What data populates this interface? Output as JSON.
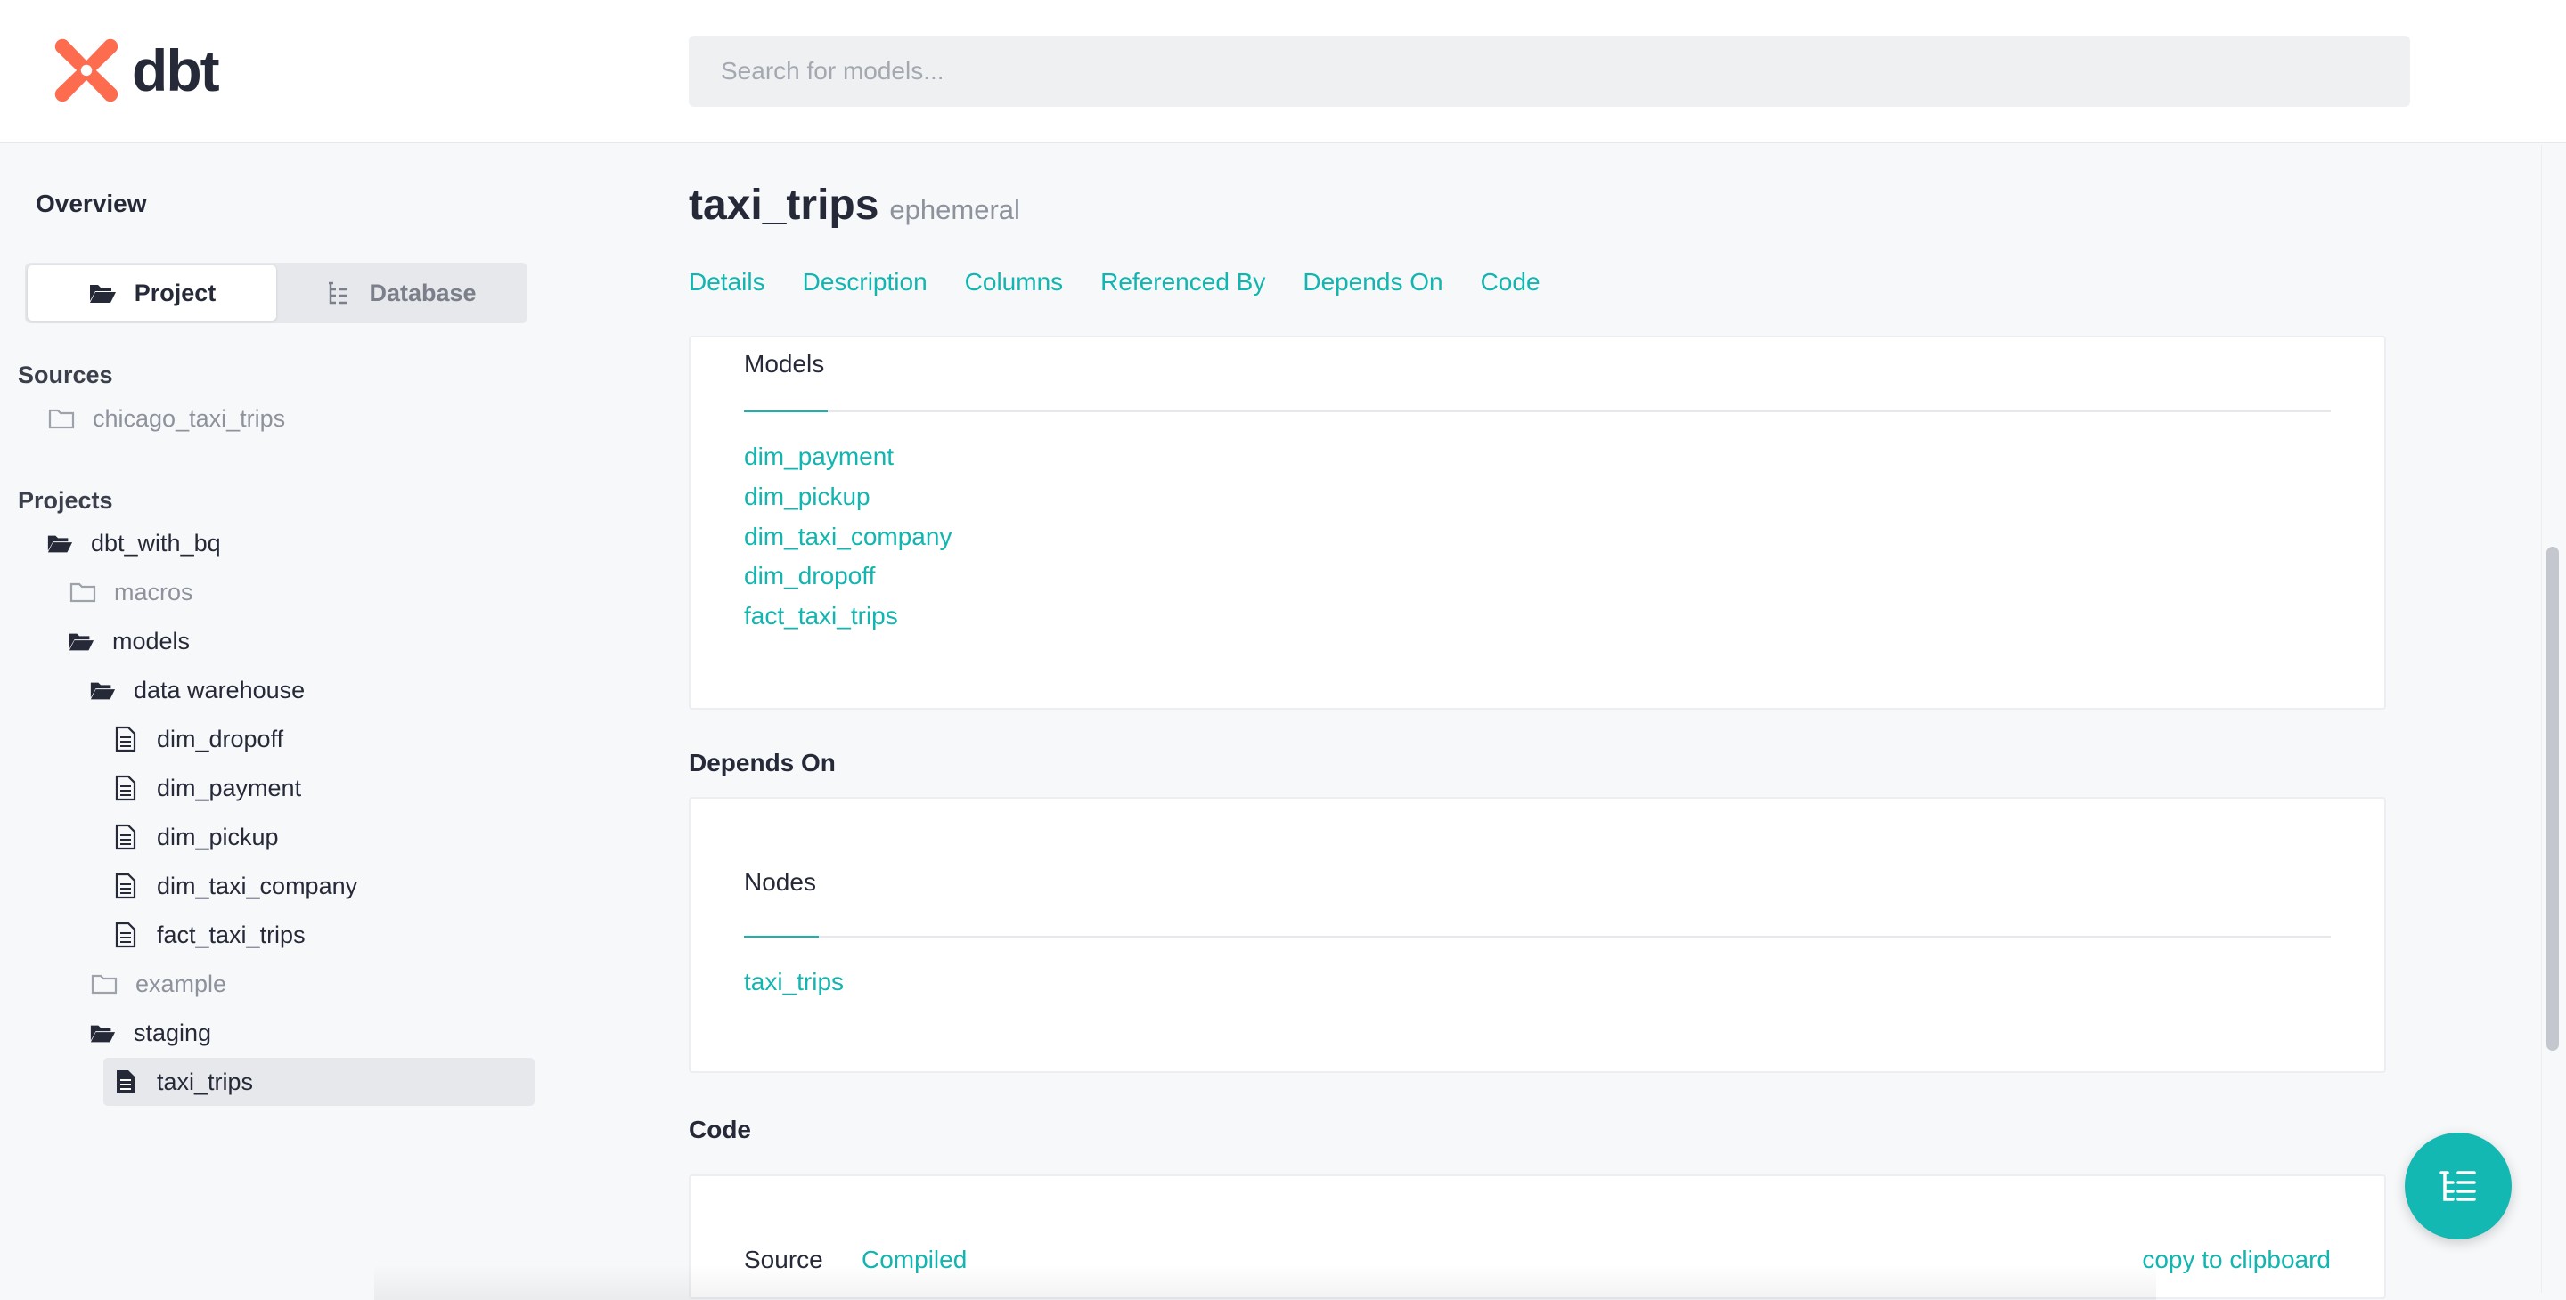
{
  "header": {
    "logo_text": "dbt",
    "search_placeholder": "Search for models..."
  },
  "sidebar": {
    "overview_label": "Overview",
    "toggle": {
      "project_label": "Project",
      "database_label": "Database"
    },
    "sources_title": "Sources",
    "sources": [
      {
        "label": "chicago_taxi_trips"
      }
    ],
    "projects_title": "Projects",
    "tree": [
      {
        "label": "dbt_with_bq",
        "type": "folder-open",
        "dim": false
      },
      {
        "label": "macros",
        "type": "folder-closed",
        "dim": true
      },
      {
        "label": "models",
        "type": "folder-open",
        "dim": false
      },
      {
        "label": "data warehouse",
        "type": "folder-open",
        "dim": false
      },
      {
        "label": "dim_dropoff",
        "type": "file",
        "dim": false
      },
      {
        "label": "dim_payment",
        "type": "file",
        "dim": false
      },
      {
        "label": "dim_pickup",
        "type": "file",
        "dim": false
      },
      {
        "label": "dim_taxi_company",
        "type": "file",
        "dim": false
      },
      {
        "label": "fact_taxi_trips",
        "type": "file",
        "dim": false
      },
      {
        "label": "example",
        "type": "folder-closed",
        "dim": true
      },
      {
        "label": "staging",
        "type": "folder-open",
        "dim": false
      },
      {
        "label": "taxi_trips",
        "type": "file-filled",
        "dim": false,
        "selected": true
      }
    ]
  },
  "main": {
    "model_name": "taxi_trips",
    "model_type": "ephemeral",
    "tabs": [
      "Details",
      "Description",
      "Columns",
      "Referenced By",
      "Depends On",
      "Code"
    ],
    "referenced_by": {
      "subtab_label": "Models",
      "models": [
        "dim_payment",
        "dim_pickup",
        "dim_taxi_company",
        "dim_dropoff",
        "fact_taxi_trips"
      ]
    },
    "depends_on": {
      "title": "Depends On",
      "subtab_label": "Nodes",
      "nodes": [
        "taxi_trips"
      ]
    },
    "code": {
      "title": "Code",
      "source_label": "Source",
      "compiled_label": "Compiled",
      "copy_label": "copy to clipboard"
    }
  },
  "colors": {
    "accent": "#12b5b0",
    "logo": "#fe6c4f",
    "text": "#262a38",
    "muted": "#8d929c"
  }
}
